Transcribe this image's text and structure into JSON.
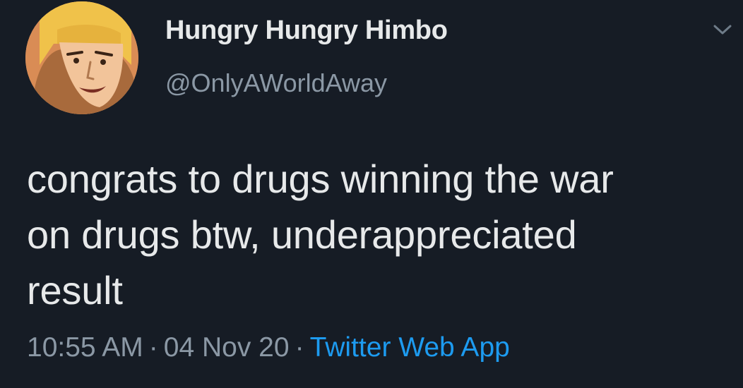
{
  "tweet": {
    "display_name": "Hungry Hungry Himbo",
    "handle": "@OnlyAWorldAway",
    "text_lines": [
      "congrats to drugs winning the war",
      "on drugs btw, underappreciated",
      "result"
    ],
    "time": "10:55 AM",
    "date": "04 Nov 20",
    "separator": "·",
    "source": "Twitter Web App",
    "menu_icon": "chevron-down-icon",
    "avatar_icon": "cartoon-face-avatar"
  },
  "colors": {
    "background": "#161c25",
    "primary_text": "#e7e9ea",
    "secondary_text": "#8b98a5",
    "link": "#1d9bf0"
  }
}
